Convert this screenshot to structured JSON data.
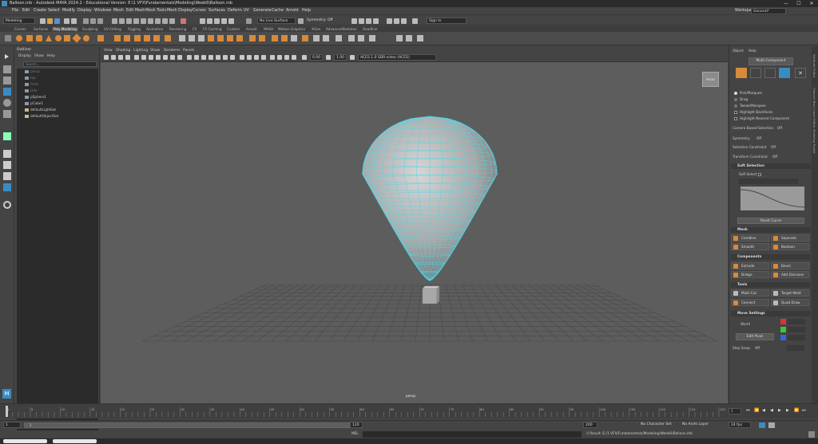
{
  "window": {
    "title": "Balloon.mb - Autodesk MAYA 2024.2 - Educational Version: E:\\1 VFX\\Fundamentals\\Modeling\\Week6\\Balloon.mb",
    "controls": [
      "—",
      "☐",
      "✕"
    ]
  },
  "menubar": {
    "items": [
      "File",
      "Edit",
      "Create",
      "Select",
      "Modify",
      "Display",
      "Windows",
      "Mesh",
      "Edit Mesh",
      "Mesh Tools",
      "Mesh Display",
      "Curves",
      "Surfaces",
      "Deform",
      "UV",
      "Generate",
      "Cache",
      "Arnold",
      "Help"
    ],
    "workspace_label": "Workspace:",
    "workspace_value": "General*"
  },
  "statusline": {
    "mode": "Modeling",
    "live_surface": "No Live Surface",
    "symmetry": "Symmetry: Off",
    "sign_in": "Sign In"
  },
  "shelf": {
    "tabs": [
      "Curves",
      "Surfaces",
      "Poly Modeling",
      "Sculpting",
      "UV Editing",
      "Rigging",
      "Animation",
      "Rendering",
      "FX",
      "FX Caching",
      "Custom",
      "Arnold",
      "MASH",
      "Motion Graphics",
      "XGen",
      "AdvancedSkeleton",
      "Deadline"
    ],
    "active_tab": "Poly Modeling"
  },
  "outliner": {
    "title": "Outliner",
    "menu": [
      "Display",
      "Show",
      "Help"
    ],
    "search_placeholder": "Search...",
    "items": [
      {
        "label": "persp",
        "dim": true
      },
      {
        "label": "top",
        "dim": true
      },
      {
        "label": "front",
        "dim": true
      },
      {
        "label": "side",
        "dim": true
      },
      {
        "label": "pSphere1",
        "dim": false
      },
      {
        "label": "pCube1",
        "dim": false
      },
      {
        "label": "defaultLightSet",
        "dim": false
      },
      {
        "label": "defaultObjectSet",
        "dim": false
      }
    ]
  },
  "viewport": {
    "menu": [
      "View",
      "Shading",
      "Lighting",
      "Show",
      "Renderer",
      "Panels"
    ],
    "exposure": "0.00",
    "gamma": "1.00",
    "colorspace": "ACES 1.0 SDR-video (ACES)",
    "viewcube_label": "FRONT",
    "camera_label": "persp",
    "wire_color": "#4fd7e8"
  },
  "toolkit": {
    "menu": [
      "Object",
      "Help"
    ],
    "multi_component": "Multi-Component",
    "pick_options": [
      "Pick/Marquee",
      "Drag",
      "Tweak/Marquee"
    ],
    "highlight_backfaces": "Highlight Backfaces",
    "highlight_nearest": "Highlight Nearest Component",
    "camera_based": "Camera Based Selection",
    "camera_based_value": "Off",
    "symmetry": "Symmetry",
    "symmetry_value": "Off",
    "selection_constraint": "Selection Constraint",
    "selection_constraint_value": "Off",
    "transform_constraint": "Transform Constraint",
    "transform_constraint_value": "Off",
    "soft_selection": "Soft Selection",
    "soft_select": "Soft Select",
    "reset_curve": "Reset Curve",
    "mesh_section": "Mesh",
    "mesh_tools": [
      "Combine",
      "Separate",
      "Smooth",
      "Boolean"
    ],
    "components_section": "Components",
    "components_tools": [
      "Extrude",
      "Bevel",
      "Bridge",
      "Add Divisions"
    ],
    "tools_section": "Tools",
    "tools_tools": [
      "Multi-Cut",
      "Target Weld",
      "Connect",
      "Quad Draw"
    ],
    "move_section": "Move Settings",
    "world": "World",
    "edit_pivot": "Edit Pivot",
    "step_snap": "Step Snap:",
    "step_snap_value": "Off"
  },
  "sidestrip": [
    "Attribute Editor",
    "Channel Box / Layer Editor",
    "Modeling Toolkit"
  ],
  "timeline": {
    "ticks": [
      "1",
      "5",
      "10",
      "15",
      "20",
      "25",
      "30",
      "35",
      "40",
      "45",
      "50",
      "55",
      "60",
      "65",
      "70",
      "75",
      "80",
      "85",
      "90",
      "95",
      "100",
      "105",
      "110",
      "115",
      "120"
    ],
    "current_frame": "1"
  },
  "rangebar": {
    "start": "1",
    "range_start": "1",
    "range_end": "120",
    "end": "200",
    "fps": "24 fps",
    "character_set": "No Character Set",
    "anim_layer": "No Anim Layer"
  },
  "cmdline": {
    "lang": "MEL",
    "result": "// Result: E:/1 VFX/Fundamentals/Modeling/Week6/Balloon.mb"
  }
}
